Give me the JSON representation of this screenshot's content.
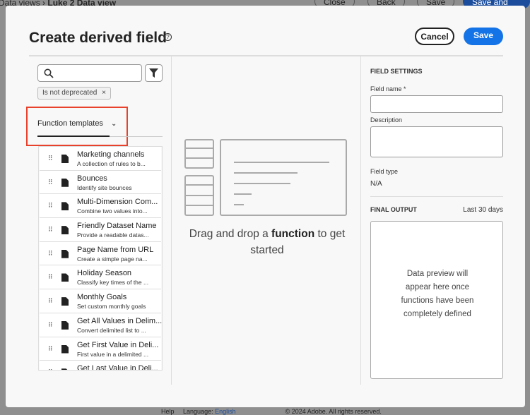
{
  "background": {
    "breadcrumb_parent": "Data views",
    "breadcrumb_current": "Luke 2 Data view",
    "buttons": [
      "Close",
      "Back",
      "Save",
      "Save and continue"
    ],
    "footer": {
      "help": "Help",
      "language_label": "Language:",
      "language": "English",
      "copyright": "© 2024 Adobe. All rights reserved."
    }
  },
  "dialog": {
    "title": "Create derived field",
    "cancel": "Cancel",
    "save": "Save"
  },
  "left": {
    "search_placeholder": "",
    "tag": "Is not deprecated",
    "tag_close": "×",
    "dropdown": "Function templates",
    "items": [
      {
        "title": "Marketing channels",
        "desc": "A collection of rules to b..."
      },
      {
        "title": "Bounces",
        "desc": "Identify site bounces"
      },
      {
        "title": "Multi-Dimension Com...",
        "desc": "Combine two values into..."
      },
      {
        "title": "Friendly Dataset Name",
        "desc": "Provide a readable datas..."
      },
      {
        "title": "Page Name from URL",
        "desc": "Create a simple page na..."
      },
      {
        "title": "Holiday Season",
        "desc": "Classify key times of the ..."
      },
      {
        "title": "Monthly Goals",
        "desc": "Set custom monthly goals"
      },
      {
        "title": "Get All Values in Delim...",
        "desc": "Convert delimited list to ..."
      },
      {
        "title": "Get First Value in Deli...",
        "desc": "First value in a delimited ..."
      },
      {
        "title": "Get Last Value in Deli...",
        "desc": ""
      }
    ]
  },
  "canvas": {
    "prefix": "Drag and drop a ",
    "bold": "function",
    "suffix": " to get started"
  },
  "settings": {
    "header": "FIELD SETTINGS",
    "field_name_label": "Field name",
    "required": "*",
    "field_name_value": "",
    "description_label": "Description",
    "description_value": "",
    "field_type_label": "Field type",
    "field_type_value": "N/A",
    "final_output": "FINAL OUTPUT",
    "range": "Last 30 days",
    "preview": "Data preview will appear here once functions have been completely defined"
  }
}
